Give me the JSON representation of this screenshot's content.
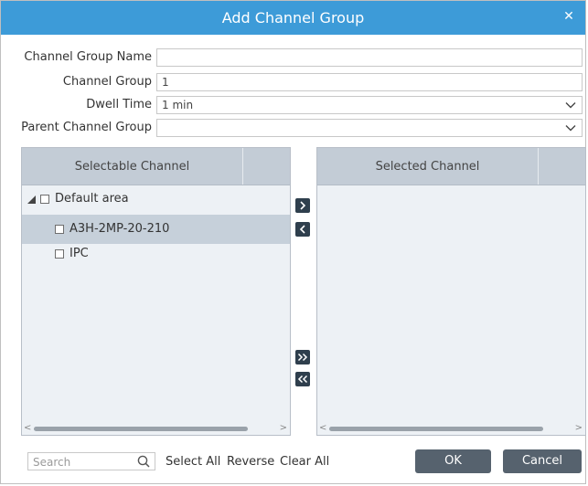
{
  "dialog": {
    "title": "Add Channel Group"
  },
  "form": {
    "name_label": "Channel Group Name",
    "name_value": "",
    "group_label": "Channel Group",
    "group_value": "1",
    "dwell_label": "Dwell Time",
    "dwell_value": "1 min",
    "parent_label": "Parent Channel Group",
    "parent_value": ""
  },
  "left_panel": {
    "header": "Selectable Channel",
    "root": "Default area",
    "items": [
      "A3H-2MP-20-210",
      "IPC"
    ]
  },
  "right_panel": {
    "header": "Selected Channel"
  },
  "footer": {
    "search_placeholder": "Search",
    "select_all": "Select All",
    "reverse": "Reverse",
    "clear_all": "Clear All",
    "ok": "OK",
    "cancel": "Cancel"
  },
  "colors": {
    "title_bar": "#3d9bd8",
    "panel_bg": "#edf1f5",
    "panel_header": "#c3ccd6",
    "selected_row": "#c6d0da",
    "button": "#56626e",
    "arrow_button": "#2f3f4d"
  }
}
